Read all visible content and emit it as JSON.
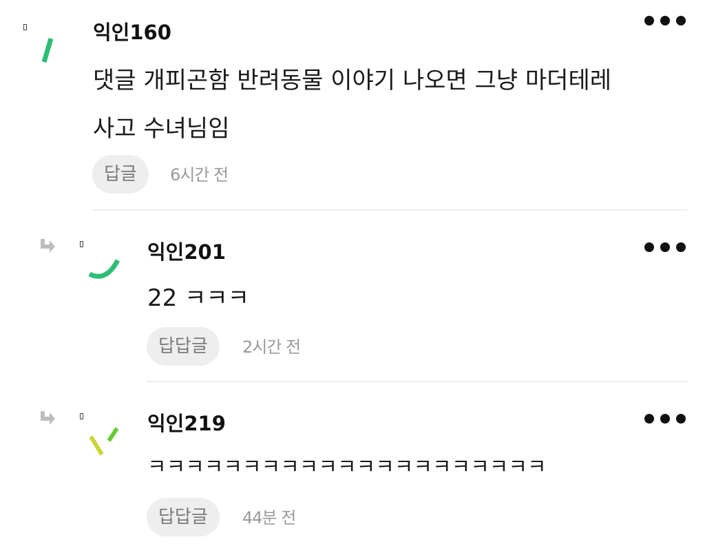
{
  "comments": [
    {
      "author": "익인160",
      "lines": [
        "댓글 개피곤함 반려동물 이야기 나오면 그냥 마더테레",
        "사고 수녀님임"
      ],
      "reply_label": "답글",
      "time": "6시간 전",
      "avatar_icon": "green-stroke-avatar-icon",
      "is_reply": false
    },
    {
      "author": "익인201",
      "lines": [
        "22 ㅋㅋㅋ"
      ],
      "reply_label": "답답글",
      "time": "2시간 전",
      "avatar_icon": "green-arc-avatar-icon",
      "is_reply": true
    },
    {
      "author": "익인219",
      "lines": [
        "ㅋㅋㅋㅋㅋㅋㅋㅋㅋㅋㅋㅋㅋㅋㅋㅋㅋㅋㅋㅋㅋ"
      ],
      "reply_label": "답답글",
      "time": "44분 전",
      "avatar_icon": "yellow-green-strokes-avatar-icon",
      "is_reply": true
    }
  ],
  "colors": {
    "accent_green": "#2dbd74",
    "lime": "#66cc33",
    "yellow_green": "#c8d637",
    "reply_arrow": "#bdbdbd",
    "button_bg": "#eeeeee",
    "divider": "#eeeeee"
  }
}
